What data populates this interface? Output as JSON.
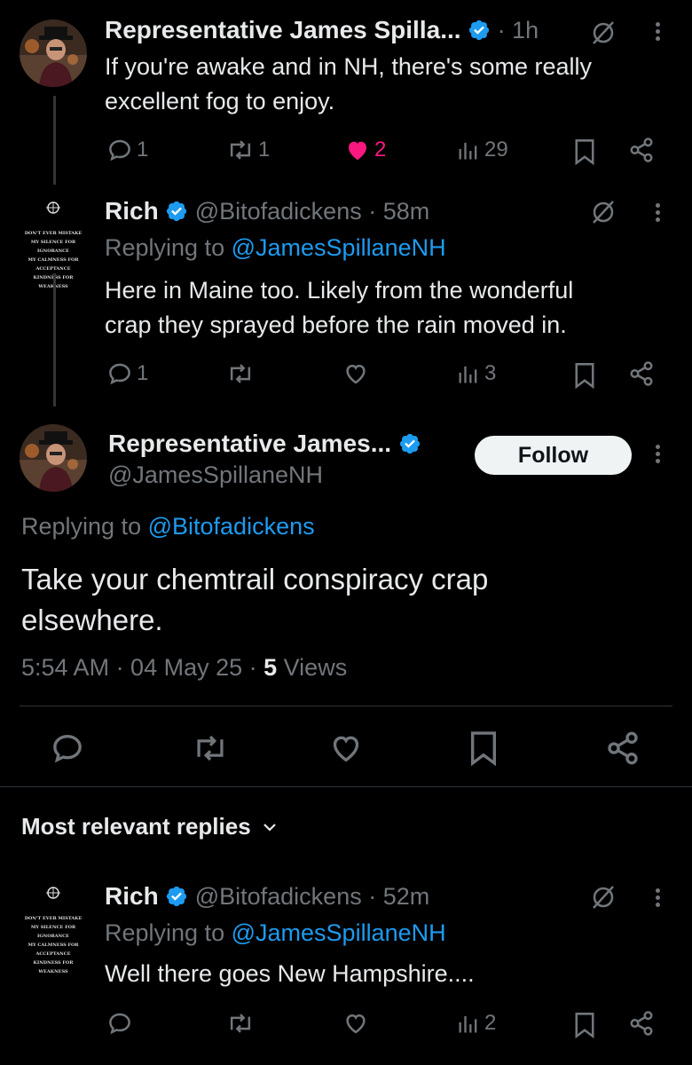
{
  "tweet1": {
    "author_name": "Representative James Spilla...",
    "time": "· 1h",
    "text_line1": "If you're awake and in NH, there's some really",
    "text_line2": "excellent fog to enjoy.",
    "replies": "1",
    "retweets": "1",
    "likes": "2",
    "views": "29",
    "liked": true
  },
  "tweet2": {
    "author_name": "Rich",
    "handle_time": "@Bitofadickens · 58m",
    "replying_prefix": "Replying to",
    "replying_handle": "@JamesSpillaneNH",
    "text_line1": "Here in Maine too. Likely from the wonderful",
    "text_line2": "crap they sprayed before the rain moved in.",
    "replies": "1",
    "views": "3"
  },
  "main_tweet": {
    "author_name": "Representative James...",
    "handle": "@JamesSpillaneNH",
    "follow_label": "Follow",
    "replying_prefix": "Replying to",
    "replying_handle": "@Bitofadickens",
    "text_line1": "Take your chemtrail conspiracy crap",
    "text_line2": "elsewhere.",
    "timestamp": "5:54 AM · 04 May 25 · ",
    "views_count": "5",
    "views_label": " Views"
  },
  "replies_sort": {
    "label": "Most relevant replies"
  },
  "reply1": {
    "author_name": "Rich",
    "handle_time": "@Bitofadickens · 52m",
    "replying_prefix": "Replying to",
    "replying_handle": "@JamesSpillaneNH",
    "text": "Well there goes New Hampshire....",
    "views": "2"
  },
  "avatar_text": {
    "line1": "DON'T EVER MISTAKE",
    "line2": "MY SILENCE FOR IGNORANCE",
    "line3": "MY CALMNESS FOR ACCEPTANCE",
    "line4": "KINDNESS FOR WEAKNESS"
  },
  "colors": {
    "background": "#000000",
    "text": "#e7e9ea",
    "secondary": "#71767b",
    "accent": "#1d9bf0",
    "like": "#f91880"
  }
}
